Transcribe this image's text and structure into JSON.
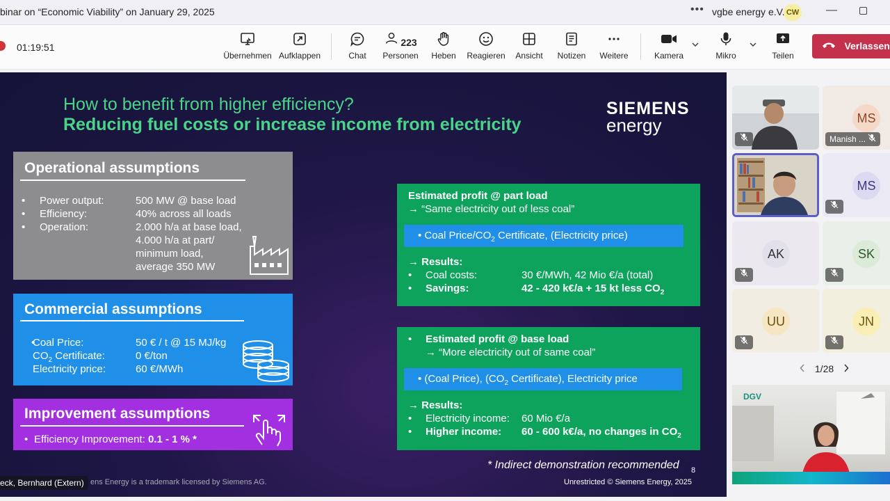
{
  "window": {
    "title": "binar on “Economic Viability” on January 29, 2025",
    "more_label": "•••",
    "org": "vgbe energy e.V.",
    "user_initials": "CW",
    "minimize_label": "—"
  },
  "toolbar": {
    "timer": "01:19:51",
    "buttons": [
      {
        "id": "takeover",
        "label": "Übernehmen",
        "icon": "share-screen-icon"
      },
      {
        "id": "popout",
        "label": "Aufklappen",
        "icon": "pop-out-icon"
      },
      {
        "id": "chat",
        "label": "Chat",
        "icon": "chat-icon"
      },
      {
        "id": "people",
        "label": "Personen",
        "icon": "people-icon",
        "count": "223"
      },
      {
        "id": "raise",
        "label": "Heben",
        "icon": "hand-icon"
      },
      {
        "id": "react",
        "label": "Reagieren",
        "icon": "smiley-icon"
      },
      {
        "id": "view",
        "label": "Ansicht",
        "icon": "grid-icon"
      },
      {
        "id": "notes",
        "label": "Notizen",
        "icon": "notes-icon"
      },
      {
        "id": "more",
        "label": "Weitere",
        "icon": "more-icon"
      },
      {
        "id": "camera",
        "label": "Kamera",
        "icon": "camera-icon"
      },
      {
        "id": "mic",
        "label": "Mikro",
        "icon": "mic-icon"
      },
      {
        "id": "share",
        "label": "Teilen",
        "icon": "share-icon"
      }
    ],
    "leave_label": "Verlassen",
    "leave_color": "#c4314b"
  },
  "slide": {
    "title1": "How to benefit from higher efficiency?",
    "title2": "Reducing fuel costs or increase income from electricity",
    "logo_line1": "SIEMENS",
    "logo_line2": "energy",
    "operational": {
      "heading": "Operational assumptions",
      "rows": [
        {
          "label": "Power output:",
          "value": "500 MW @ base load"
        },
        {
          "label": "Efficiency:",
          "value": "40% across all loads"
        },
        {
          "label": "Operation:",
          "value": "2.000 h/a at base load,"
        }
      ],
      "cont": [
        "4.000 h/a at part/",
        "minimum load,",
        "average 350 MW"
      ]
    },
    "commercial": {
      "heading": "Commercial assumptions",
      "rows": [
        {
          "label": "Coal Price:",
          "value": "50 € / t @ 15 MJ/kg"
        },
        {
          "label_a": "CO",
          "label_sub": "2",
          "label_b": " Certificate:",
          "value": "0 €/ton"
        },
        {
          "label": "Electricity price:",
          "value": "60 €/MWh"
        }
      ]
    },
    "improvement": {
      "heading": "Improvement assumptions",
      "row_label": "Efficiency Improvement: ",
      "row_value": "0.1 - 1 % *"
    },
    "part_load": {
      "title": "Estimated profit @ part load",
      "subtitle": "→ “Same electricity out of less coal”",
      "bar_a": "Coal Price/CO",
      "bar_sub": "2",
      "bar_b": " Certificate, (Electricity price)",
      "results": "→ Results:",
      "r1_label": "Coal costs:",
      "r1_value": "30 €/MWh, 42 Mio €/a (total)",
      "r2_label": "Savings:",
      "r2_value_a": "42 - 420 k€/a + 15 kt less CO",
      "r2_value_sub": "2"
    },
    "base_load": {
      "title": "Estimated profit @ base load",
      "subtitle": "→ “More electricity out of same coal”",
      "bar_a": "(Coal Price), (CO",
      "bar_sub": "2",
      "bar_b": " Certificate), Electricity price",
      "results": "→ Results:",
      "r1_label": "Electricity income:",
      "r1_value": "60 Mio €/a",
      "r2_label": "Higher income:",
      "r2_value_a": "60 - 600 k€/a, no changes in CO",
      "r2_value_sub": "2"
    },
    "note": "* Indirect demonstration recommended",
    "page_number": "8",
    "footer_left": "ens Energy is a trademark licensed by Siemens AG.",
    "footer_right": "Unrestricted © Siemens Energy, 2025",
    "presenter_name": "eck, Bernhard (Extern)"
  },
  "participants": {
    "tiles": [
      {
        "initials": "",
        "name": ""
      },
      {
        "initials": "MS",
        "name": "Manish ..."
      },
      {
        "initials": "",
        "name": ""
      },
      {
        "initials": "MS",
        "name": ""
      },
      {
        "initials": "AK",
        "name": ""
      },
      {
        "initials": "SK",
        "name": ""
      },
      {
        "initials": "UU",
        "name": ""
      },
      {
        "initials": "JN",
        "name": ""
      }
    ],
    "pager": "1/28",
    "video_logo": "DGV"
  }
}
